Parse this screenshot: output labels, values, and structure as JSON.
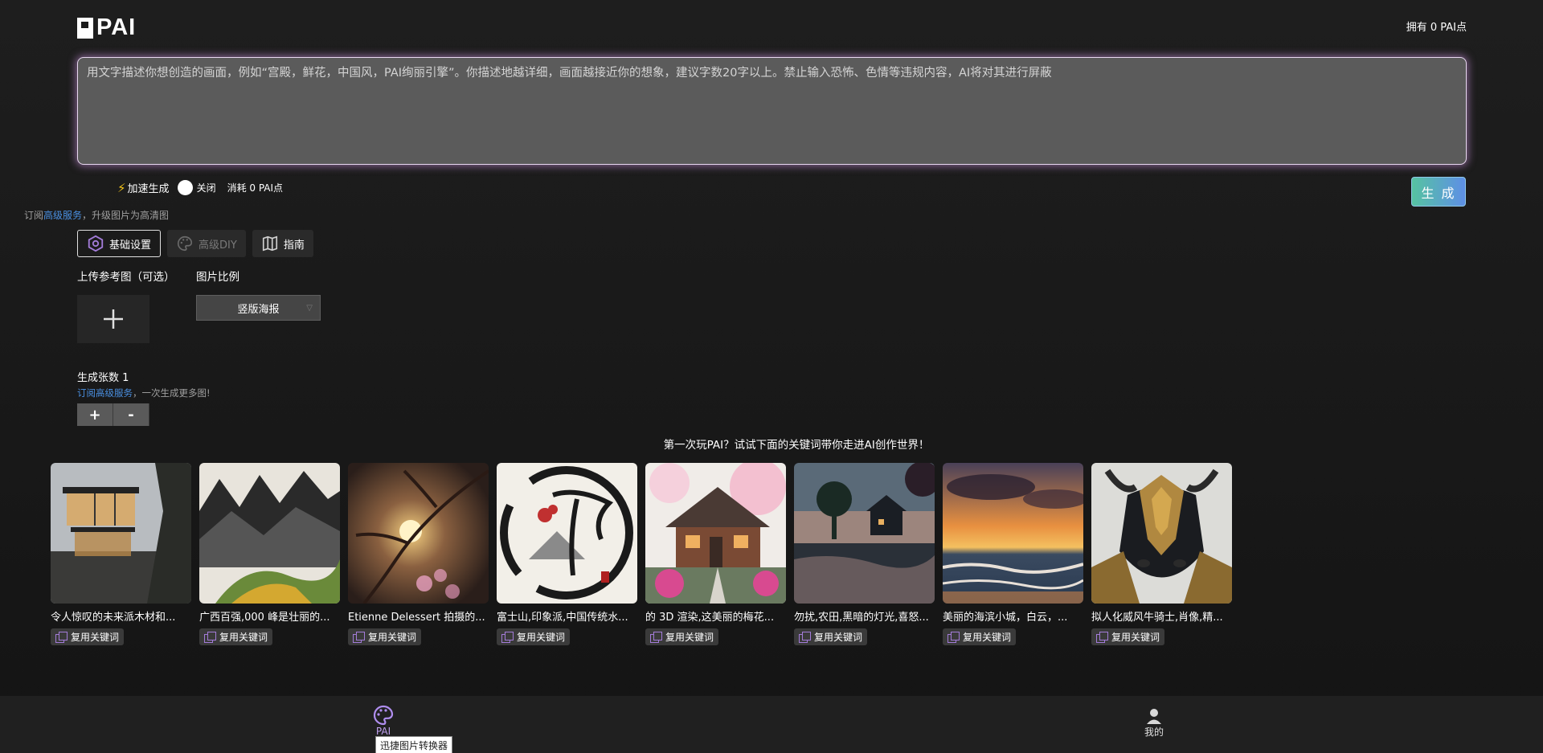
{
  "header": {
    "logo_text": "PAI",
    "points_label": "拥有 0 PAI点"
  },
  "prompt": {
    "placeholder": "用文字描述你想创造的画面，例如“宫殿，鲜花，中国风，PAI绚丽引擎”。你描述地越详细，画面越接近你的想象，建议字数20字以上。禁止输入恐怖、色情等违规内容，AI将对其进行屏蔽"
  },
  "speed": {
    "label": "加速生成",
    "toggle_state": "关闭",
    "cost": "消耗 0 PAI点"
  },
  "generate_button": "生 成",
  "subscribe_hd": {
    "prefix": "订阅",
    "link": "高级服务",
    "suffix": "，升级图片为高清图"
  },
  "tabs": [
    {
      "label": "基础设置",
      "icon": "settings-hex-icon",
      "active": true
    },
    {
      "label": "高级DIY",
      "icon": "palette-icon",
      "disabled": true
    },
    {
      "label": "指南",
      "icon": "map-icon"
    }
  ],
  "upload": {
    "label": "上传参考图（可选）"
  },
  "ratio": {
    "label": "图片比例",
    "selected": "竖版海报"
  },
  "count": {
    "label": "生成张数 1",
    "sub_link": "订阅高级服务",
    "sub_suffix": "，一次生成更多图!",
    "plus": "+",
    "minus": "-"
  },
  "try_title": "第一次玩PAI？试试下面的关键词带你走进AI创作世界！",
  "gallery": [
    {
      "title": "令人惊叹的未来派木材和...",
      "reuse": "复用关键词"
    },
    {
      "title": "广西百强,000 峰是壮丽的...",
      "reuse": "复用关键词"
    },
    {
      "title": "Etienne Delessert 拍摄的...",
      "reuse": "复用关键词"
    },
    {
      "title": "富士山,印象派,中国传统水...",
      "reuse": "复用关键词"
    },
    {
      "title": "的 3D 渲染,这美丽的梅花...",
      "reuse": "复用关键词"
    },
    {
      "title": "勿扰,农田,黑暗的灯光,喜怒...",
      "reuse": "复用关键词"
    },
    {
      "title": "美丽的海滨小城，白云，...",
      "reuse": "复用关键词"
    },
    {
      "title": "拟人化威风牛骑士,肖像,精...",
      "reuse": "复用关键词"
    }
  ],
  "bottom_nav": {
    "pai_label": "PAI",
    "me_label": "我的",
    "tooltip": "迅捷图片转换器"
  }
}
